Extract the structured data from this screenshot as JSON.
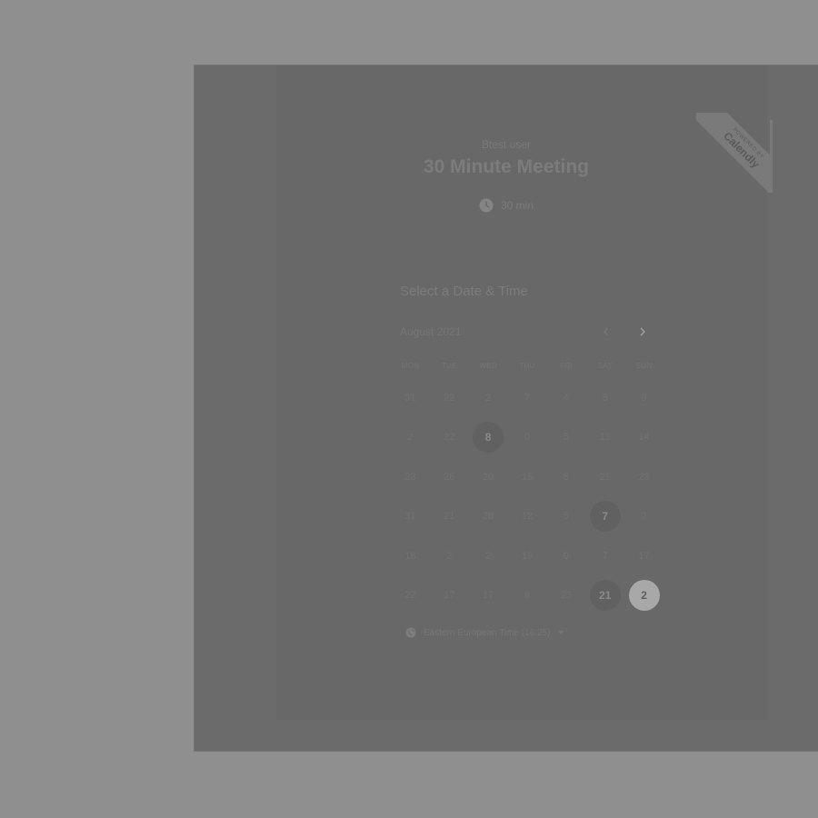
{
  "header": {
    "user_name": "Btest user",
    "event_title": "30 Minute Meeting",
    "duration": "30 min"
  },
  "badge": {
    "line1": "powered by",
    "line2": "Calendly"
  },
  "calendar": {
    "heading": "Select a Date & Time",
    "month": "August 2021",
    "weekdays": [
      "MON",
      "TUE",
      "WED",
      "THU",
      "FRI",
      "SAT",
      "SUN"
    ],
    "days": [
      {
        "label": "31",
        "state": "disabled"
      },
      {
        "label": "22",
        "state": "disabled"
      },
      {
        "label": "2",
        "state": "disabled"
      },
      {
        "label": "7",
        "state": "disabled"
      },
      {
        "label": "4",
        "state": "disabled"
      },
      {
        "label": "5",
        "state": "disabled"
      },
      {
        "label": "9",
        "state": "disabled"
      },
      {
        "label": "2",
        "state": "disabled"
      },
      {
        "label": "22",
        "state": "disabled"
      },
      {
        "label": "8",
        "state": "available"
      },
      {
        "label": "0",
        "state": "disabled"
      },
      {
        "label": "5",
        "state": "disabled"
      },
      {
        "label": "13",
        "state": "disabled"
      },
      {
        "label": "14",
        "state": "disabled"
      },
      {
        "label": "23",
        "state": "disabled"
      },
      {
        "label": "26",
        "state": "disabled"
      },
      {
        "label": "20",
        "state": "disabled"
      },
      {
        "label": "15",
        "state": "disabled"
      },
      {
        "label": "8",
        "state": "disabled"
      },
      {
        "label": "21",
        "state": "disabled"
      },
      {
        "label": "23",
        "state": "disabled"
      },
      {
        "label": "31",
        "state": "disabled"
      },
      {
        "label": "21",
        "state": "disabled"
      },
      {
        "label": "28",
        "state": "disabled"
      },
      {
        "label": "12",
        "state": "disabled"
      },
      {
        "label": "5",
        "state": "disabled"
      },
      {
        "label": "7",
        "state": "available"
      },
      {
        "label": "2",
        "state": "disabled"
      },
      {
        "label": "18",
        "state": "disabled"
      },
      {
        "label": "2",
        "state": "disabled"
      },
      {
        "label": "2",
        "state": "disabled"
      },
      {
        "label": "19",
        "state": "disabled"
      },
      {
        "label": "0",
        "state": "disabled"
      },
      {
        "label": "7",
        "state": "disabled"
      },
      {
        "label": "17",
        "state": "disabled"
      },
      {
        "label": "22",
        "state": "disabled"
      },
      {
        "label": "17",
        "state": "disabled"
      },
      {
        "label": "17",
        "state": "disabled"
      },
      {
        "label": "8",
        "state": "disabled"
      },
      {
        "label": "23",
        "state": "disabled"
      },
      {
        "label": "21",
        "state": "available"
      },
      {
        "label": "2",
        "state": "selected"
      }
    ]
  },
  "timezone": {
    "label": "Eastern European Time (16:25)"
  },
  "icons": {
    "clock": "clock-icon",
    "prev": "chevron-left-icon",
    "next": "chevron-right-icon",
    "globe": "globe-icon",
    "caret": "caret-down-icon"
  }
}
